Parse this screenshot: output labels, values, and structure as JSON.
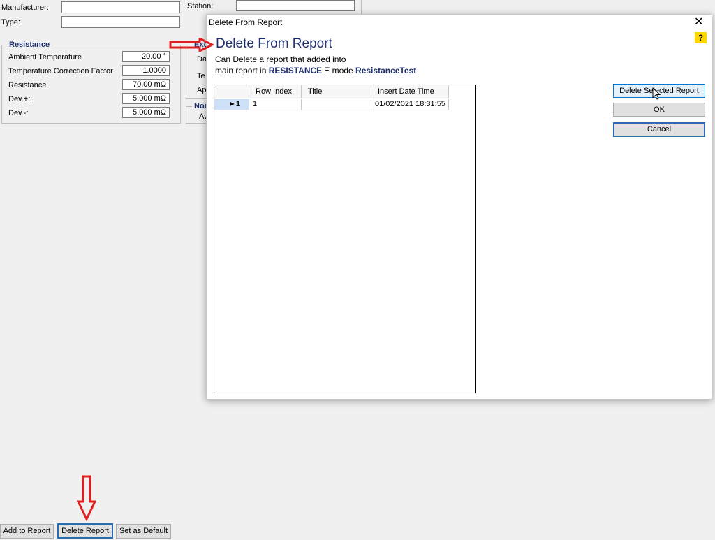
{
  "main": {
    "manufacturer_label": "Manufacturer:",
    "type_label": "Type:",
    "station_label": "Station:",
    "resistance_group": {
      "title": "Resistance",
      "rows": [
        {
          "label": "Ambient Temperature",
          "value": "20.00 °"
        },
        {
          "label": "Temperature Correction Factor",
          "value": "1.0000"
        },
        {
          "label": "Resistance",
          "value": "70.00 mΩ"
        },
        {
          "label": "Dev.+:",
          "value": "5.000 mΩ"
        },
        {
          "label": "Dev.-:",
          "value": "5.000 mΩ"
        }
      ]
    },
    "ext_group": {
      "title": "Ext",
      "labels": [
        "Da",
        "Te",
        "Ap"
      ]
    },
    "noi_group": {
      "title": "Noi",
      "labels": [
        "Av"
      ]
    },
    "buttons": {
      "add": "Add to Report",
      "delete": "Delete Report",
      "default": "Set as Default"
    }
  },
  "dialog": {
    "window_title": "Delete From Report",
    "heading": "Delete From Report",
    "desc_line1": "Can Delete a report that added into",
    "desc_prefix": "main report in",
    "test_name": "RESISTANCE",
    "mode_symbol": "Ξ",
    "mode_label": "mode",
    "mode_name": "ResistanceTest",
    "help_label": "?",
    "close_label": "✕",
    "grid": {
      "columns": [
        "Row Index",
        "Title",
        "Insert Date Time"
      ],
      "rows": [
        {
          "marker": "►1",
          "row_index": "1",
          "title": "",
          "insert_time": "01/02/2021 18:31:55"
        }
      ]
    },
    "buttons": {
      "delete_selected": "Delete Selected Report",
      "ok": "OK",
      "cancel": "Cancel"
    }
  },
  "colors": {
    "annotation_arrow": "#e02020",
    "heading": "#1f2f6e",
    "selection": "#cce0f7"
  }
}
